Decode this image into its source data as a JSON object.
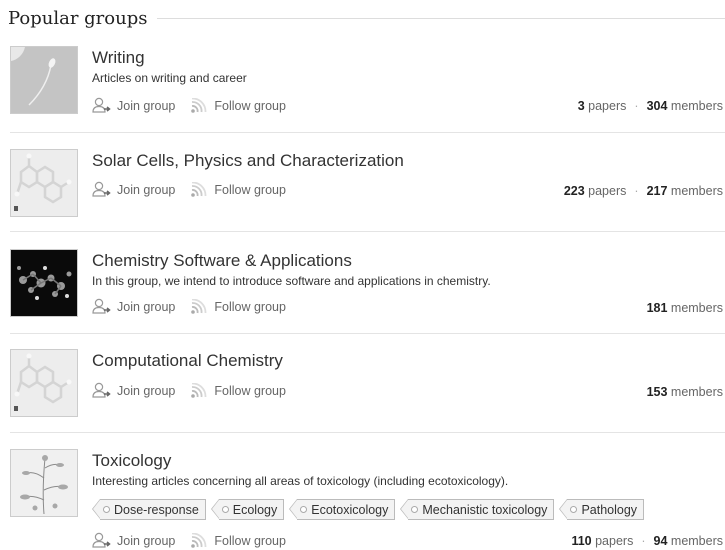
{
  "header": {
    "title": "Popular groups"
  },
  "labels": {
    "join": "Join group",
    "follow": "Follow group",
    "papers_word": "papers",
    "members_word": "members",
    "separator": "·"
  },
  "groups": [
    {
      "name": "Writing",
      "description": "Articles on writing and career",
      "papers": "3",
      "members": "304",
      "icon": "writing-thumbnail"
    },
    {
      "name": "Solar Cells, Physics and Characterization",
      "papers": "223",
      "members": "217",
      "icon": "molecule-thumbnail"
    },
    {
      "name": "Chemistry Software & Applications",
      "description": "In this group, we intend to introduce software and applications in chemistry.",
      "members": "181",
      "icon": "molecular-render-thumbnail"
    },
    {
      "name": "Computational Chemistry",
      "members": "153",
      "icon": "molecule-thumbnail"
    },
    {
      "name": "Toxicology",
      "description": "Interesting articles concerning all areas of toxicology (including ecotoxicology).",
      "tags": [
        "Dose-response",
        "Ecology",
        "Ecotoxicology",
        "Mechanistic toxicology",
        "Pathology"
      ],
      "papers": "110",
      "members": "94",
      "icon": "plant-illustration-thumbnail"
    }
  ]
}
